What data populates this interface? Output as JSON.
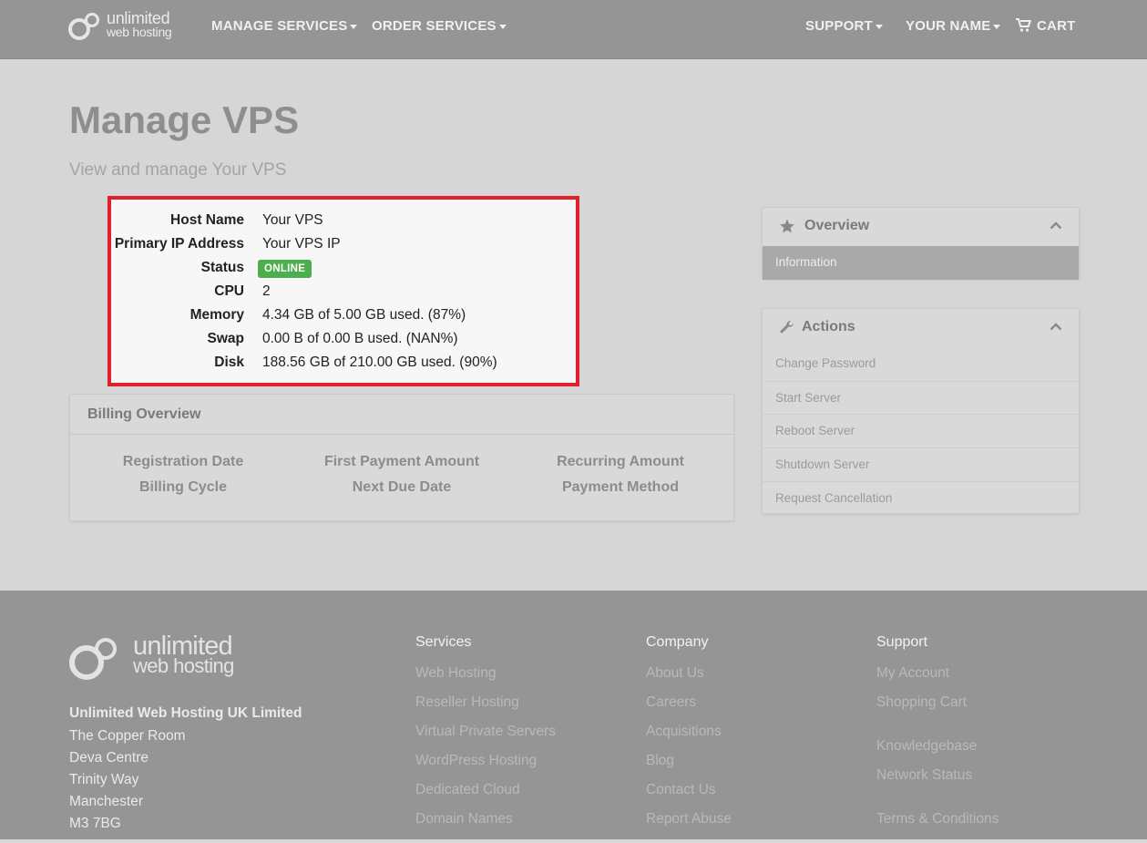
{
  "brand": {
    "line1": "unlimited",
    "line2": "web hosting"
  },
  "nav": {
    "manage_services": "MANAGE SERVICES",
    "order_services": "ORDER SERVICES",
    "support": "SUPPORT",
    "your_name": "YOUR NAME",
    "cart": "CART"
  },
  "header": {
    "title": "Manage VPS",
    "subtitle": "View and manage Your VPS"
  },
  "info": {
    "rows": [
      {
        "label": "Host Name",
        "value": "Your VPS"
      },
      {
        "label": "Primary IP Address",
        "value": "Your VPS IP"
      },
      {
        "label": "Status",
        "value": "ONLINE"
      },
      {
        "label": "CPU",
        "value": "2"
      },
      {
        "label": "Memory",
        "value": "4.34 GB of 5.00 GB used. (87%)"
      },
      {
        "label": "Swap",
        "value": "0.00 B of 0.00 B used. (NAN%)"
      },
      {
        "label": "Disk",
        "value": "188.56 GB of 210.00 GB used. (90%)"
      }
    ]
  },
  "billing": {
    "title": "Billing Overview",
    "labels": [
      "Registration Date",
      "First Payment Amount",
      "Recurring Amount",
      "Billing Cycle",
      "Next Due Date",
      "Payment Method"
    ]
  },
  "sidebar": {
    "overview": {
      "title": "Overview",
      "items": [
        "Information"
      ]
    },
    "actions": {
      "title": "Actions",
      "items": [
        "Change Password",
        "Start Server",
        "Reboot Server",
        "Shutdown Server",
        "Request Cancellation"
      ]
    }
  },
  "footer": {
    "logo": {
      "line1": "unlimited",
      "line2": "web hosting"
    },
    "company": "Unlimited Web Hosting UK Limited",
    "address": [
      "The Copper Room",
      "Deva Centre",
      "Trinity Way",
      "Manchester",
      "M3 7BG"
    ],
    "services": {
      "title": "Services",
      "links": [
        "Web Hosting",
        "Reseller Hosting",
        "Virtual Private Servers",
        "WordPress Hosting",
        "Dedicated Cloud",
        "Domain Names"
      ]
    },
    "company_col": {
      "title": "Company",
      "links": [
        "About Us",
        "Careers",
        "Acquisitions",
        "Blog",
        "Contact Us",
        "Report Abuse"
      ]
    },
    "support": {
      "title": "Support",
      "links": [
        "My Account",
        "Shopping Cart",
        "Knowledgebase",
        "Network Status",
        "Terms & Conditions"
      ]
    }
  },
  "colors": {
    "status_online": "#4cae4c",
    "highlight_border": "#e0202a",
    "navbar": "#959595"
  },
  "icons": {
    "star": "star-icon",
    "wrench": "wrench-icon",
    "cart": "cart-icon",
    "chevron": "chevron-up-icon"
  }
}
